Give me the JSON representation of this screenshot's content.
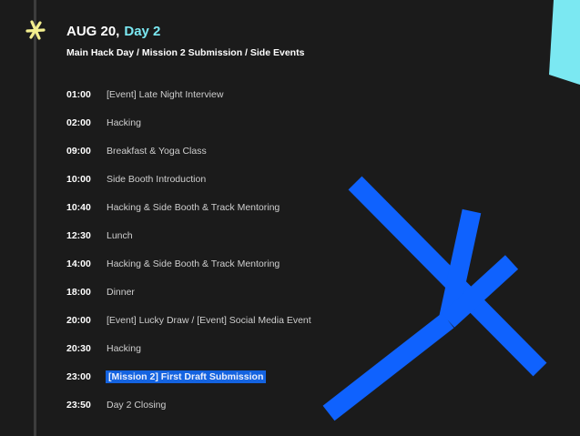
{
  "header": {
    "date": "AUG 20,",
    "day": "Day 2",
    "subtitle": "Main Hack Day / Mission 2 Submission / Side Events"
  },
  "schedule": [
    {
      "time": "01:00",
      "event": "[Event] Late Night Interview",
      "highlighted": false
    },
    {
      "time": "02:00",
      "event": "Hacking",
      "highlighted": false
    },
    {
      "time": "09:00",
      "event": "Breakfast & Yoga Class",
      "highlighted": false
    },
    {
      "time": "10:00",
      "event": "Side Booth Introduction",
      "highlighted": false
    },
    {
      "time": "10:40",
      "event": "Hacking & Side Booth & Track Mentoring",
      "highlighted": false
    },
    {
      "time": "12:30",
      "event": "Lunch",
      "highlighted": false
    },
    {
      "time": "14:00",
      "event": "Hacking & Side Booth & Track Mentoring",
      "highlighted": false
    },
    {
      "time": "18:00",
      "event": "Dinner",
      "highlighted": false
    },
    {
      "time": "20:00",
      "event": "[Event] Lucky Draw / [Event] Social Media Event",
      "highlighted": false
    },
    {
      "time": "20:30",
      "event": "Hacking",
      "highlighted": false
    },
    {
      "time": "23:00",
      "event": "[Mission 2] First Draft Submission",
      "highlighted": true
    },
    {
      "time": "23:50",
      "event": "Day 2 Closing",
      "highlighted": false
    }
  ],
  "icons": {
    "timeline_marker": "asterisk-marker-icon",
    "decorative_graphic": "blue-asterisk-graphic",
    "corner_shape": "cyan-shape"
  },
  "colors": {
    "background": "#1b1b1b",
    "day_accent": "#7be8f2",
    "marker": "#f3ef8f",
    "graphic_blue": "#0f62fe",
    "highlight": "#1463e0",
    "cyan_shape": "#7be8f2"
  }
}
